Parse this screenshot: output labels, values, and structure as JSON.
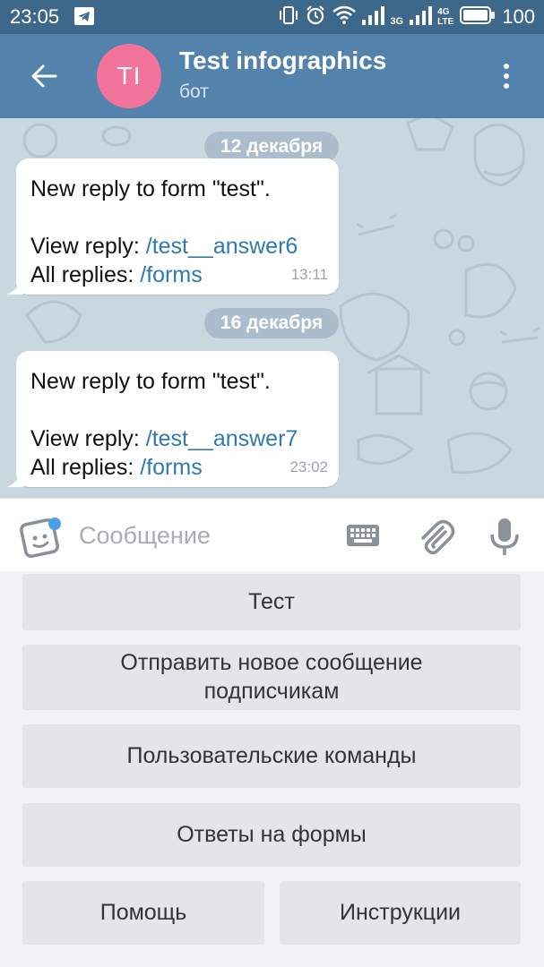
{
  "status_bar": {
    "time": "23:05",
    "network_3g": "3G",
    "network_4g": "4G",
    "network_lte": "LTE",
    "battery": "100"
  },
  "header": {
    "avatar_initials": "TI",
    "title": "Test infographics",
    "subtitle": "бот",
    "avatar_color": "#f2749a"
  },
  "chat": {
    "messages": [
      {
        "date": "12 декабря",
        "line1": "New reply to form \"test\".",
        "reply_label": "View reply: ",
        "reply_link": "/test__answer6",
        "all_label": "All replies: ",
        "all_link": "/forms",
        "time": "13:11"
      },
      {
        "date": "16 декабря",
        "line1": "New reply to form \"test\".",
        "reply_label": "View reply: ",
        "reply_link": "/test__answer7",
        "all_label": "All replies: ",
        "all_link": "/forms",
        "time": "23:02"
      }
    ]
  },
  "composer": {
    "placeholder": "Сообщение"
  },
  "bot_keyboard": {
    "buttons": [
      "Тест",
      "Отправить новое сообщение подписчикам",
      "Пользовательские команды",
      "Ответы на формы",
      "Помощь",
      "Инструкции"
    ]
  },
  "colors": {
    "header": "#5382ad",
    "status_bar": "#3e6889",
    "link": "#2f79b3",
    "chat_background": "#c9d7e1"
  },
  "icons": [
    "telegram-icon",
    "vibrate-icon",
    "alarm-icon",
    "wifi-icon",
    "signal-icon",
    "battery-icon",
    "back-arrow-icon",
    "more-vert-icon",
    "sticker-icon",
    "keyboard-icon",
    "attach-icon",
    "mic-icon"
  ]
}
